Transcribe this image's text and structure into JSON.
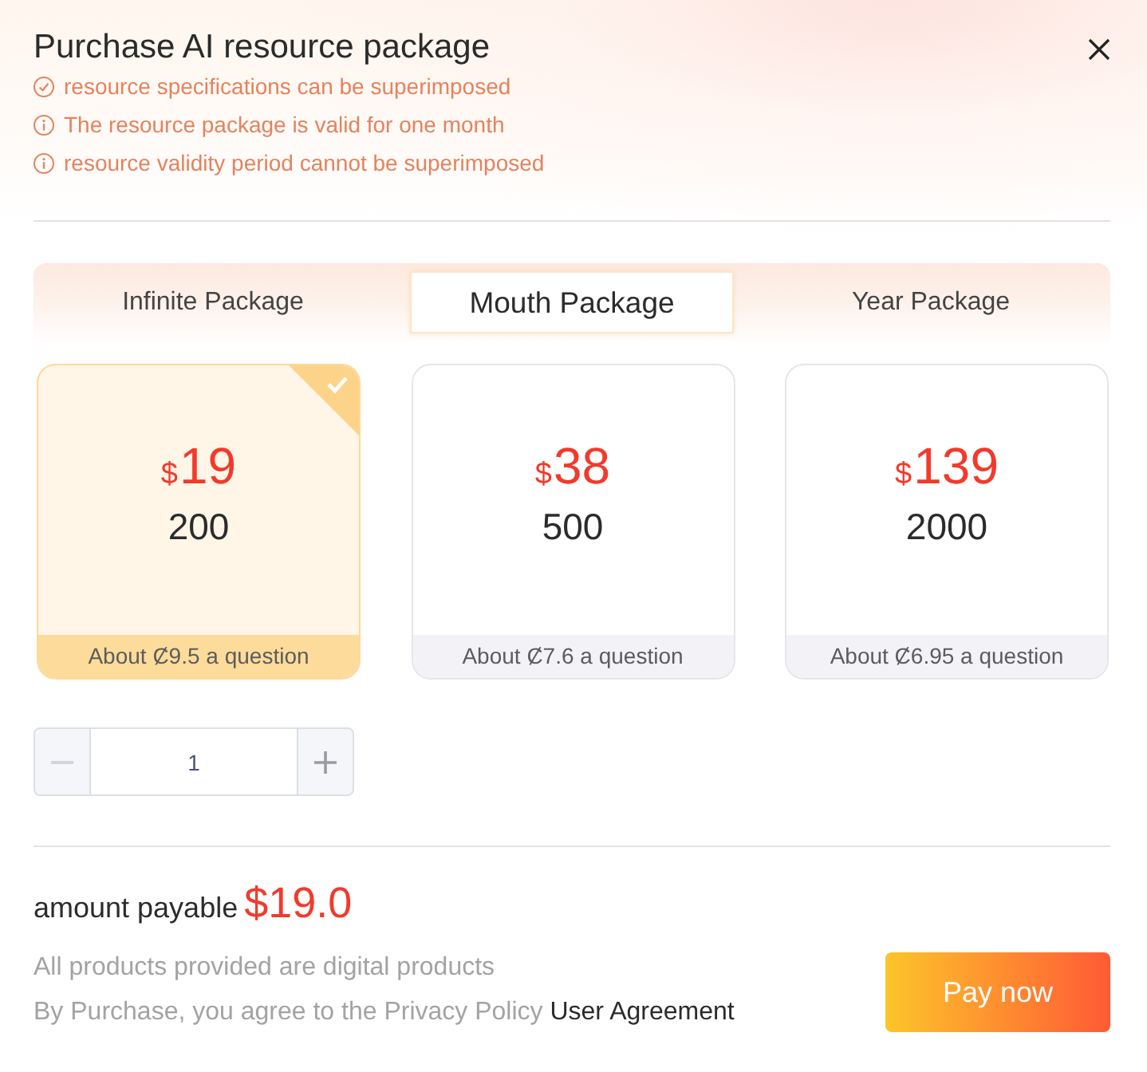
{
  "dialog": {
    "title": "Purchase AI resource package"
  },
  "notes": [
    {
      "kind": "check",
      "text": "resource specifications can be superimposed"
    },
    {
      "kind": "info",
      "text": "The resource package is valid for one month"
    },
    {
      "kind": "info",
      "text": "resource validity period cannot be superimposed"
    }
  ],
  "tabs": [
    {
      "label": "Infinite Package",
      "selected": false
    },
    {
      "label": "Mouth Package",
      "selected": true
    },
    {
      "label": "Year Package",
      "selected": false
    }
  ],
  "packages": [
    {
      "currency": "$",
      "price": "19",
      "count": "200",
      "note": "About Ȼ9.5 a question",
      "selected": true
    },
    {
      "currency": "$",
      "price": "38",
      "count": "500",
      "note": "About Ȼ7.6 a question",
      "selected": false
    },
    {
      "currency": "$",
      "price": "139",
      "count": "2000",
      "note": "About Ȼ6.95 a question",
      "selected": false
    }
  ],
  "quantity": {
    "value": "1",
    "decrease_disabled": true,
    "increase_disabled": false
  },
  "amount": {
    "label": "amount payable",
    "value": "$19.0"
  },
  "footer": {
    "notice": "All products provided are digital products",
    "agreement": "By Purchase, you agree to the Privacy Policy",
    "link": "User Agreement",
    "pay_button": "Pay now"
  }
}
